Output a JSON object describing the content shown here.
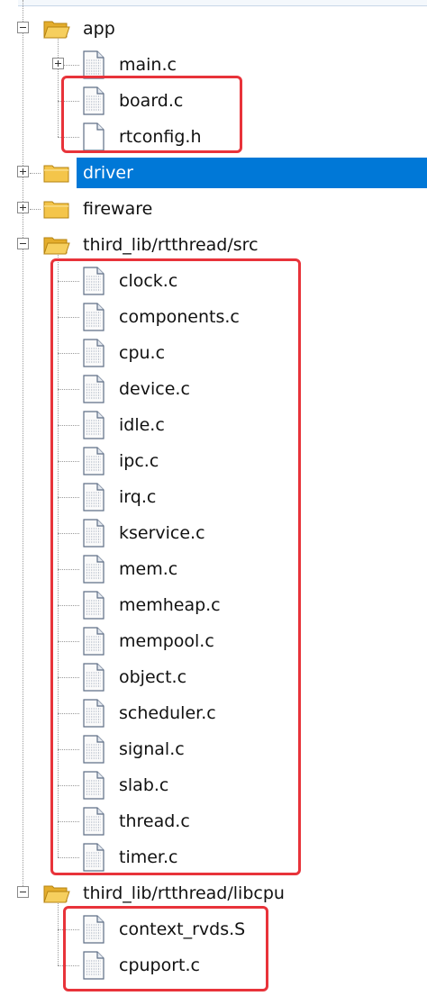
{
  "tree": {
    "nodes": [
      {
        "label": "app",
        "type": "folder",
        "state": "expanded"
      },
      {
        "label": "main.c",
        "type": "file",
        "expandable": true
      },
      {
        "label": "board.c",
        "type": "file"
      },
      {
        "label": "rtconfig.h",
        "type": "file"
      },
      {
        "label": "driver",
        "type": "folder",
        "state": "collapsed",
        "selected": true
      },
      {
        "label": "fireware",
        "type": "folder",
        "state": "collapsed"
      },
      {
        "label": "third_lib/rtthread/src",
        "type": "folder",
        "state": "expanded"
      },
      {
        "label": "clock.c",
        "type": "file"
      },
      {
        "label": "components.c",
        "type": "file"
      },
      {
        "label": "cpu.c",
        "type": "file"
      },
      {
        "label": "device.c",
        "type": "file"
      },
      {
        "label": "idle.c",
        "type": "file"
      },
      {
        "label": "ipc.c",
        "type": "file"
      },
      {
        "label": "irq.c",
        "type": "file"
      },
      {
        "label": "kservice.c",
        "type": "file"
      },
      {
        "label": "mem.c",
        "type": "file"
      },
      {
        "label": "memheap.c",
        "type": "file"
      },
      {
        "label": "mempool.c",
        "type": "file"
      },
      {
        "label": "object.c",
        "type": "file"
      },
      {
        "label": "scheduler.c",
        "type": "file"
      },
      {
        "label": "signal.c",
        "type": "file"
      },
      {
        "label": "slab.c",
        "type": "file"
      },
      {
        "label": "thread.c",
        "type": "file"
      },
      {
        "label": "timer.c",
        "type": "file"
      },
      {
        "label": "third_lib/rtthread/libcpu",
        "type": "folder",
        "state": "expanded"
      },
      {
        "label": "context_rvds.S",
        "type": "file"
      },
      {
        "label": "cpuport.c",
        "type": "file"
      }
    ]
  },
  "colors": {
    "selection": "#0078d7",
    "highlight_box": "#e8333a",
    "folder": "#f4c54a",
    "tree_lines": "#9a9a9a"
  },
  "icons": {
    "folder": "folder-icon",
    "folder_open": "folder-open-icon",
    "file": "c-source-file-icon",
    "expander_expanded": "minus-box-icon",
    "expander_collapsed": "plus-box-icon"
  }
}
